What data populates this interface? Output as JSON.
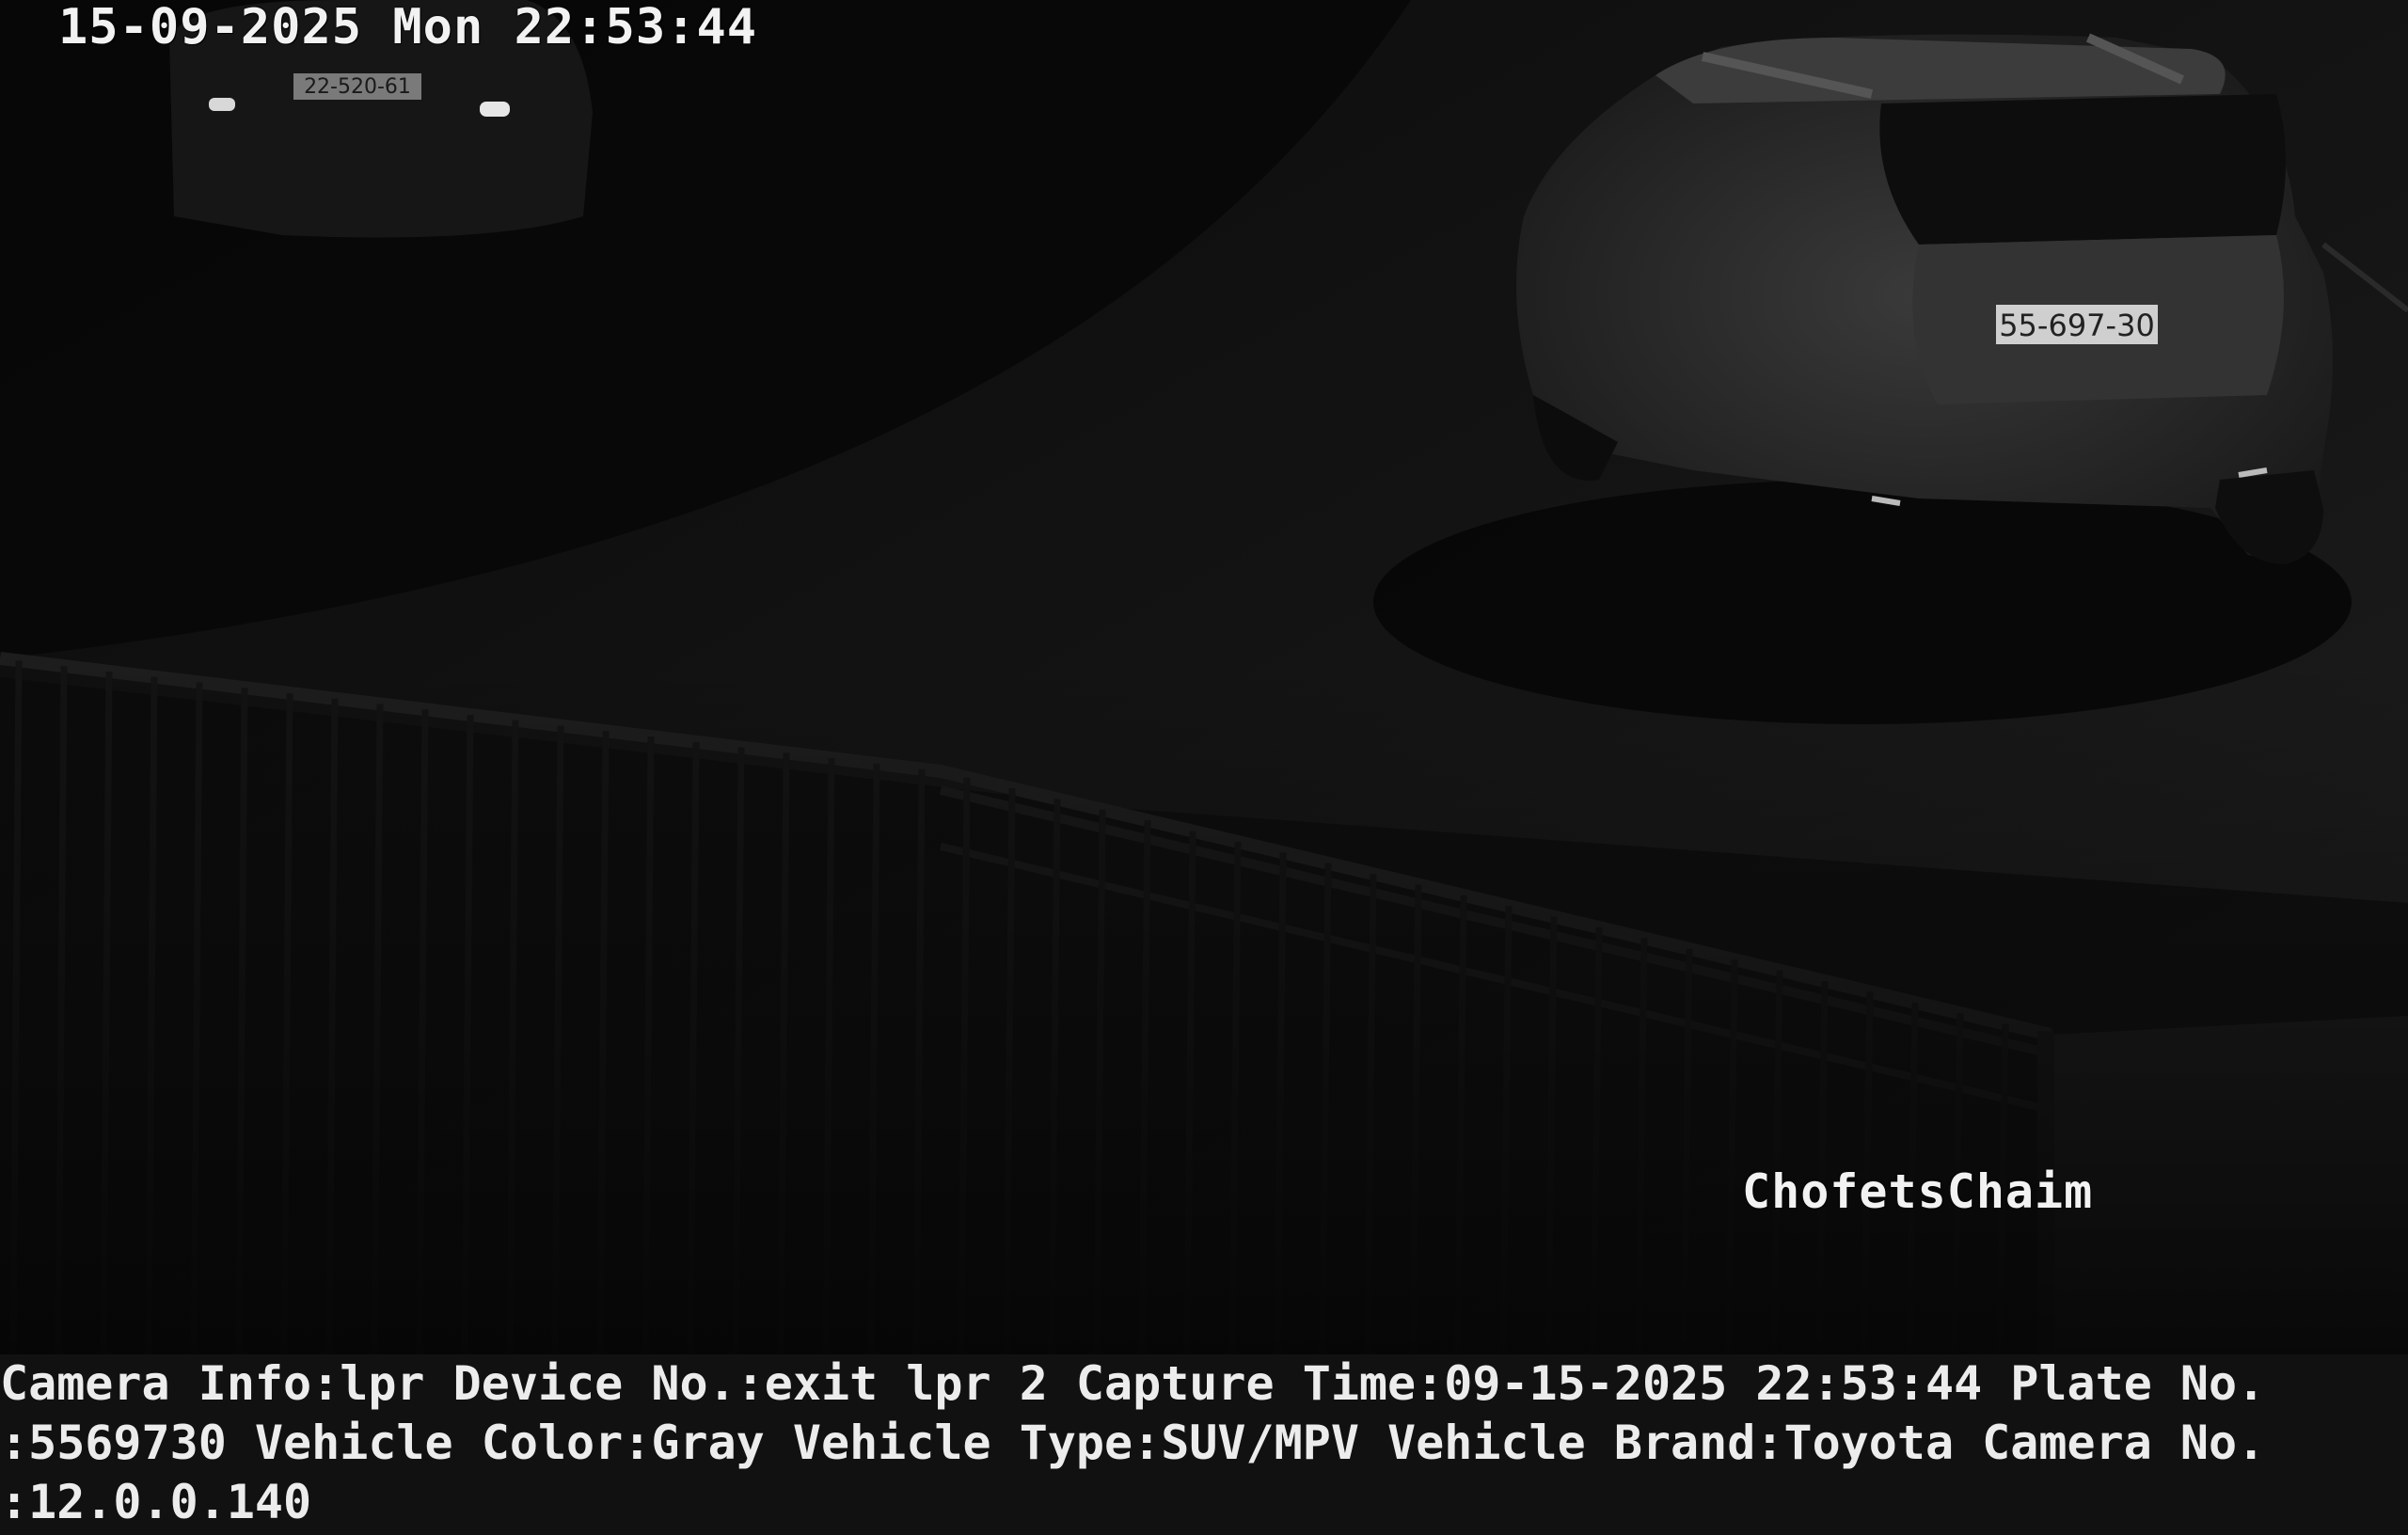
{
  "camera_overlay": {
    "timestamp": "15-09-2025 Mon 22:53:44",
    "site_label": "ChofetsChaim"
  },
  "scene": {
    "description_free": true,
    "vehicles": [
      {
        "plate_text": "55-697-30"
      },
      {
        "plate_text": "22-520-61"
      }
    ]
  },
  "info_bar": {
    "lines": [
      "Camera Info:lpr Device No.:exit lpr 2 Capture Time:09-15-2025 22:53:44 Plate No.",
      ":5569730 Vehicle Color:Gray Vehicle Type:SUV/MPV Vehicle Brand:Toyota Camera No.",
      ":12.0.0.140"
    ]
  }
}
